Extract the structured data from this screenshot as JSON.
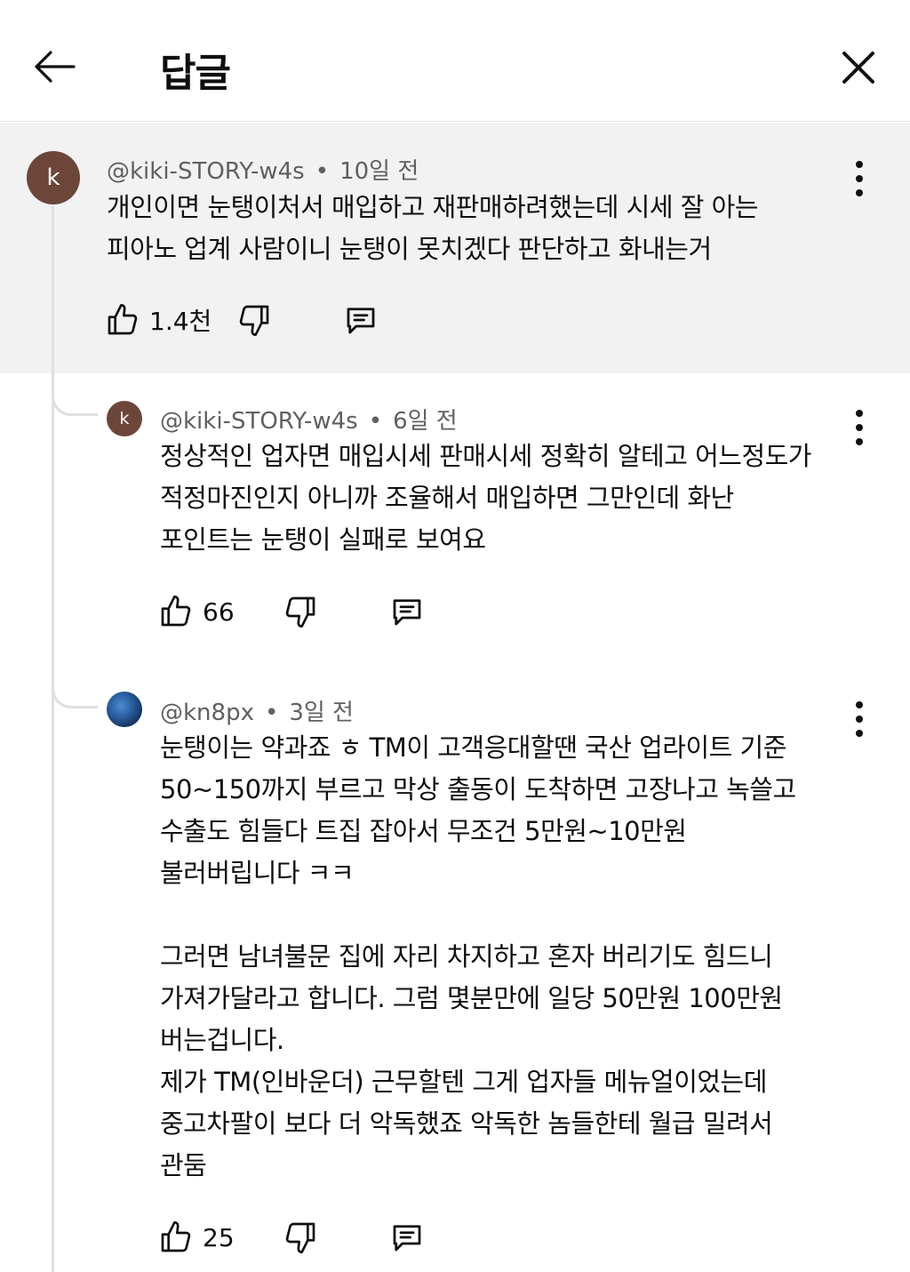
{
  "header": {
    "title": "답글",
    "back_icon": "arrow-left-icon",
    "close_icon": "close-icon"
  },
  "parent": {
    "avatar_letter": "k",
    "author": "@kiki-STORY-w4s",
    "separator": "•",
    "time": "10일 전",
    "lines": [
      "개인이면 눈탱이처서 매입하고 재판매하려했는데 시세 잘 아는",
      "피아노 업계 사람이니 눈탱이 못치겠다 판단하고 화내는거"
    ],
    "likes": "1.4천"
  },
  "replies": [
    {
      "avatar_letter": "k",
      "author": "@kiki-STORY-w4s",
      "separator": "•",
      "time": "6일 전",
      "lines": [
        "정상적인 업자면 매입시세 판매시세 정확히 알테고 어느정도가",
        "적정마진인지 아니까  조율해서 매입하면 그만인데 화난",
        "포인트는 눈탱이 실패로 보여요"
      ],
      "likes": "66"
    },
    {
      "avatar_icon": "globe-avatar",
      "author": "@kn8px",
      "separator": "•",
      "time": "3일 전",
      "lines": [
        "눈탱이는 약과죠 ㅎ TM이 고객응대할땐 국산 업라이트 기준",
        "50~150까지 부르고 막상 출동이 도착하면 고장나고 녹쓸고",
        "수출도 힘들다 트집 잡아서 무조건 5만원~10만원",
        "불러버립니다 ㅋㅋ",
        "",
        "그러면 남녀불문 집에 자리 차지하고 혼자 버리기도 힘드니",
        "가져가달라고 합니다. 그럼 몇분만에 일당 50만원 100만원",
        "버는겁니다.",
        "제가 TM(인바운더) 근무할텐 그게 업자들 메뉴얼이었는데",
        "중고차팔이 보다 더 악독했죠 악독한 놈들한테 월급 밀려서",
        "관둠"
      ],
      "likes": "25"
    }
  ],
  "icons": {
    "like": "thumbs-up-icon",
    "dislike": "thumbs-down-icon",
    "reply": "reply-comment-icon",
    "more": "more-vertical-icon"
  }
}
